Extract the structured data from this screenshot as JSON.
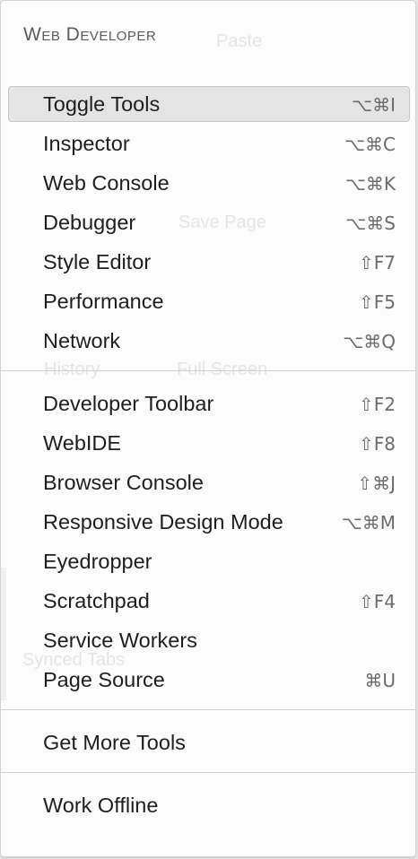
{
  "menu": {
    "title": "Web Developer",
    "groups": [
      [
        {
          "label": "Toggle Tools",
          "shortcut": "⌥⌘I",
          "selected": true
        },
        {
          "label": "Inspector",
          "shortcut": "⌥⌘C"
        },
        {
          "label": "Web Console",
          "shortcut": "⌥⌘K"
        },
        {
          "label": "Debugger",
          "shortcut": "⌥⌘S"
        },
        {
          "label": "Style Editor",
          "shortcut": "⇧F7"
        },
        {
          "label": "Performance",
          "shortcut": "⇧F5"
        },
        {
          "label": "Network",
          "shortcut": "⌥⌘Q"
        }
      ],
      [
        {
          "label": "Developer Toolbar",
          "shortcut": "⇧F2"
        },
        {
          "label": "WebIDE",
          "shortcut": "⇧F8"
        },
        {
          "label": "Browser Console",
          "shortcut": "⇧⌘J"
        },
        {
          "label": "Responsive Design Mode",
          "shortcut": "⌥⌘M"
        },
        {
          "label": "Eyedropper",
          "shortcut": ""
        },
        {
          "label": "Scratchpad",
          "shortcut": "⇧F4"
        },
        {
          "label": "Service Workers",
          "shortcut": ""
        },
        {
          "label": "Page Source",
          "shortcut": "⌘U"
        }
      ],
      [
        {
          "label": "Get More Tools",
          "shortcut": ""
        }
      ],
      [
        {
          "label": "Work Offline",
          "shortcut": ""
        }
      ]
    ]
  }
}
